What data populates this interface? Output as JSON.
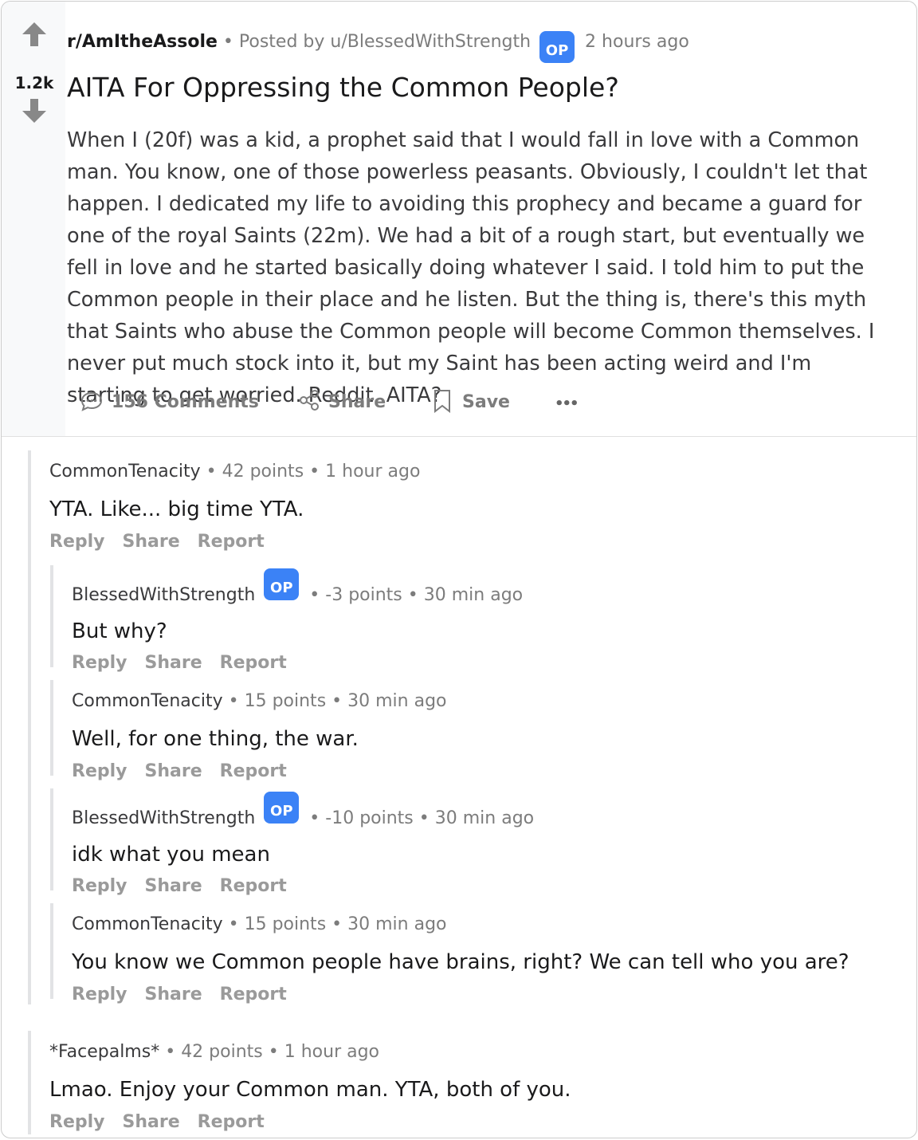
{
  "post": {
    "score": "1.2k",
    "subreddit": "r/AmItheAssole",
    "separator": "•",
    "posted_by": "Posted by u/BlessedWithStrength",
    "op_badge": "OP",
    "time": "2 hours ago",
    "title": "AITA For Oppressing the Common People?",
    "body": "When I (20f) was a kid, a prophet said that I would fall in love with a Common man. You know, one of those powerless peasants. Obviously, I couldn't let that happen. I dedicated my life to avoiding this prophecy and became a guard for one of the royal Saints (22m). We had a bit of a rough start, but eventually we fell in love and he started basically doing whatever I said. I told him to put the Common people in their place and he listen. But the thing is, there's this myth that Saints who abuse the Common people will become Common themselves. I never put much stock into it, but my Saint has been acting weird and I'm starting to get worried. Reddit, AITA?",
    "actions": {
      "comments": "156 Comments",
      "share": "Share",
      "save": "Save",
      "more": "•••"
    },
    "colors": {
      "op_badge": "#3b82f6",
      "vote_bg": "#f8f9fa"
    }
  },
  "comment_actions": {
    "reply": "Reply",
    "share": "Share",
    "report": "Report"
  },
  "comments": [
    {
      "author": "CommonTenacity",
      "points": "42 points",
      "time": "1 hour ago",
      "text": "YTA. Like... big time YTA."
    },
    {
      "author": "BlessedWithStrength",
      "op": "OP",
      "points": "-3 points",
      "time": "30 min ago",
      "text": "But why?"
    },
    {
      "author": "CommonTenacity",
      "points": "15 points",
      "time": "30 min ago",
      "text": "Well, for one thing, the war."
    },
    {
      "author": "BlessedWithStrength",
      "op": "OP",
      "points": "-10 points",
      "time": "30 min ago",
      "text": "idk what you mean"
    },
    {
      "author": "CommonTenacity",
      "points": "15 points",
      "time": "30 min ago",
      "text": "You know we Common people have brains, right? We can tell who you are?"
    },
    {
      "author": "*Facepalms*",
      "points": "42 points",
      "time": "1 hour ago",
      "text": "Lmao. Enjoy your Common man. YTA, both of you."
    }
  ]
}
